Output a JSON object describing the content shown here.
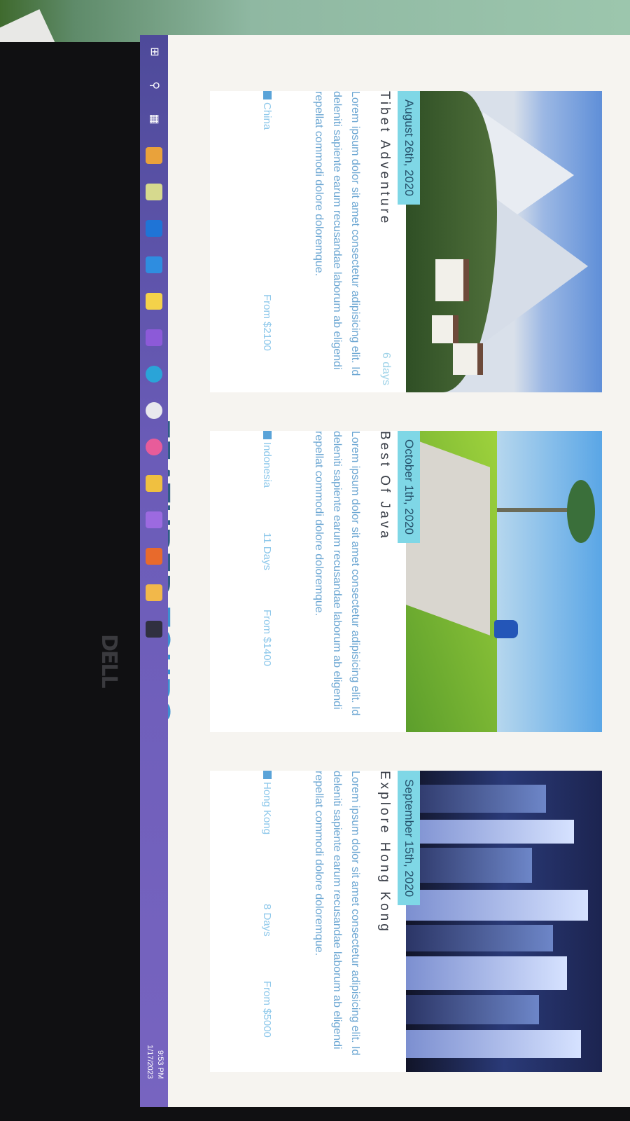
{
  "device": {
    "brand_label": "DELL"
  },
  "page": {
    "title_part1": "FEATURED",
    "title_part2": "TOURS"
  },
  "tours": [
    {
      "date": "August 26th, 2020",
      "title": "Tibet Adventure",
      "days": "6 days",
      "description": "Lorem ipsum dolor sit amet consectetur adipisicing elit. Id deleniti sapiente earum recusandae laborum ab eligendi repellat commodi dolore doloremque.",
      "country": "China",
      "price": "From $2100"
    },
    {
      "date": "October 1th, 2020",
      "title": "Best Of Java",
      "days": "11 Days",
      "description": "Lorem ipsum dolor sit amet consectetur adipisicing elit. Id deleniti sapiente earum recusandae laborum ab eligendi repellat commodi dolore doloremque.",
      "country": "Indonesia",
      "price": "From $1400"
    },
    {
      "date": "September 15th, 2020",
      "title": "Explore Hong Kong",
      "days": "8 Days",
      "description": "Lorem ipsum dolor sit amet consectetur adipisicing elit. Id deleniti sapiente earum recusandae laborum ab eligendi repellat commodi dolore doloremque.",
      "country": "Hong Kong",
      "price": "From $5000"
    }
  ],
  "taskbar": {
    "time": "9:53 PM",
    "date": "1/17/2023",
    "icons": [
      "windows-icon",
      "search-icon",
      "task-view-icon",
      "chrome-icon",
      "notepad-icon",
      "outlook-icon",
      "vscode-icon",
      "sticky-notes-icon",
      "visual-studio-icon",
      "edge-icon",
      "settings-icon",
      "paint-icon",
      "folder-icon",
      "visual-studio-code-insiders-icon",
      "office-icon",
      "terminal-icon"
    ]
  },
  "colors": {
    "title": "#2f5d86",
    "title_accent": "#3d8fd0",
    "date_badge": "#7fd7e6",
    "text_muted": "#6ba6d2",
    "taskbar": "#6b5cb8"
  }
}
